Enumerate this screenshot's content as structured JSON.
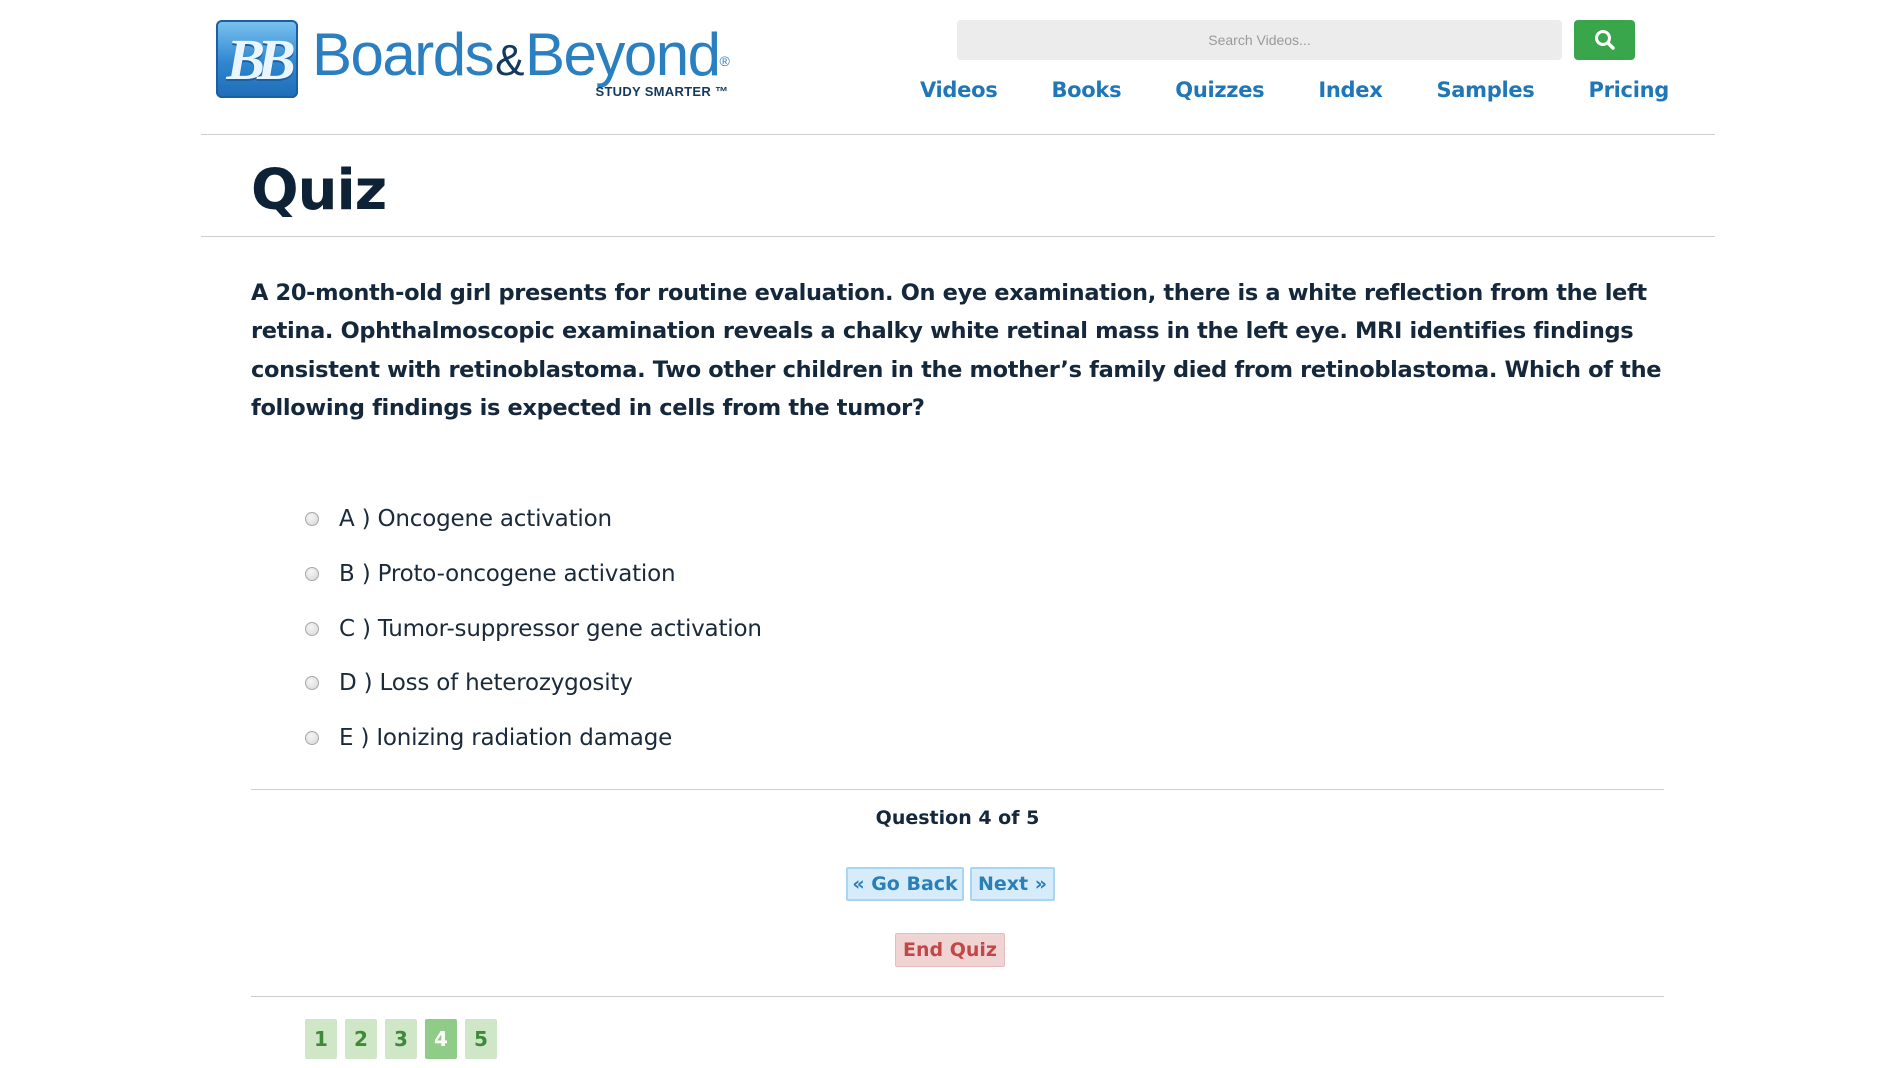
{
  "header": {
    "logo": {
      "badge": "BB",
      "name_part1": "Boards",
      "name_amp": "&",
      "name_part2": "Beyond",
      "registered": "®",
      "tagline": "STUDY SMARTER ™"
    },
    "search": {
      "placeholder": "Search Videos..."
    },
    "search_button_icon": "search-icon",
    "nav": [
      "Videos",
      "Books",
      "Quizzes",
      "Index",
      "Samples",
      "Pricing"
    ]
  },
  "page": {
    "title": "Quiz"
  },
  "quiz": {
    "question": "A 20-month-old girl presents for routine evaluation. On eye examination, there is a white reflection from the left retina. Ophthalmoscopic examination reveals a chalky white retinal mass in the left eye. MRI identifies findings consistent with retinoblastoma. Two other children in the mother’s family died from retinoblastoma. Which of the following findings is expected in cells from the tumor?",
    "options": [
      "A ) Oncogene activation",
      "B ) Proto-oncogene activation",
      "C ) Tumor-suppressor gene activation",
      "D ) Loss of heterozygosity",
      "E ) Ionizing radiation damage"
    ],
    "progress": "Question 4 of 5",
    "buttons": {
      "back": "« Go Back",
      "next": "Next »",
      "end": "End Quiz"
    },
    "pages": [
      "1",
      "2",
      "3",
      "4",
      "5"
    ],
    "current_page": "4"
  },
  "colors": {
    "brand_blue": "#1f77b8",
    "search_green": "#3aa64b",
    "end_red": "#c24848",
    "pager_green": "#cfe6c7",
    "pager_active": "#8fcc87"
  }
}
